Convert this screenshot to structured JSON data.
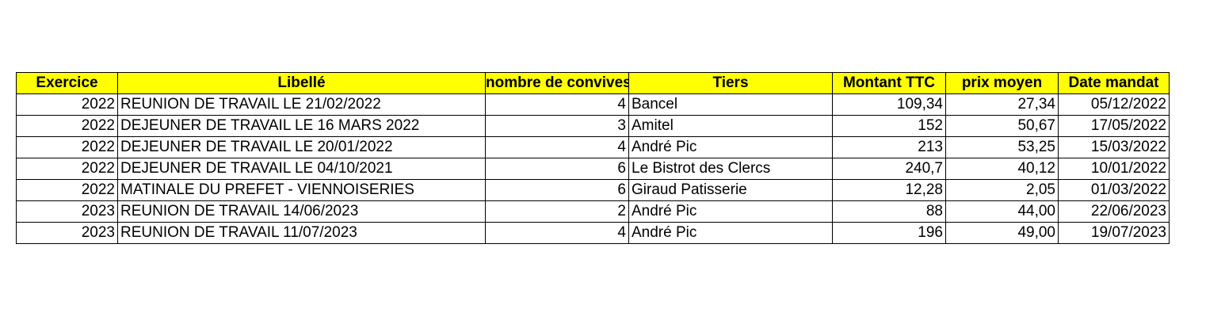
{
  "table": {
    "headers": [
      "Exercice",
      "Libellé",
      "nombre de convives",
      "Tiers",
      "Montant TTC",
      "prix moyen",
      "Date mandat"
    ],
    "rows": [
      [
        "2022",
        "REUNION DE TRAVAIL LE 21/02/2022",
        "4",
        "Bancel",
        "109,34",
        "27,34",
        "05/12/2022"
      ],
      [
        "2022",
        "DEJEUNER DE TRAVAIL LE 16 MARS 2022",
        "3",
        "Amitel",
        "152",
        "50,67",
        "17/05/2022"
      ],
      [
        "2022",
        "DEJEUNER DE TRAVAIL LE 20/01/2022",
        "4",
        "André Pic",
        "213",
        "53,25",
        "15/03/2022"
      ],
      [
        "2022",
        "DEJEUNER DE TRAVAIL LE 04/10/2021",
        "6",
        "Le Bistrot des Clercs",
        "240,7",
        "40,12",
        "10/01/2022"
      ],
      [
        "2022",
        "MATINALE DU PREFET - VIENNOISERIES",
        "6",
        "Giraud Patisserie",
        "12,28",
        "2,05",
        "01/03/2022"
      ],
      [
        "2023",
        "REUNION DE TRAVAIL 14/06/2023",
        "2",
        "André Pic",
        "88",
        "44,00",
        "22/06/2023"
      ],
      [
        "2023",
        "REUNION DE TRAVAIL 11/07/2023",
        "4",
        "André Pic",
        "196",
        "49,00",
        "19/07/2023"
      ]
    ]
  },
  "colors": {
    "header_bg": "#ffff00",
    "border": "#000000",
    "text": "#000000"
  }
}
